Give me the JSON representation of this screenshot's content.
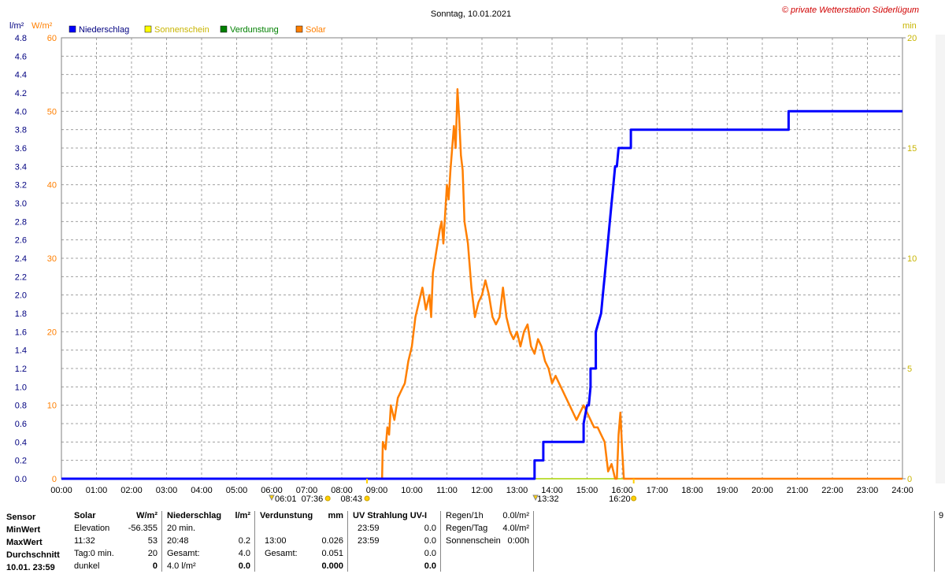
{
  "header": {
    "title": "Sonntag, 10.01.2021",
    "copyright": "© private Wetterstation Süderlügum",
    "unit_left1": "l/m²",
    "unit_left2": "W/m²",
    "unit_right": "min"
  },
  "legend": [
    {
      "label": "Niederschlag",
      "color": "#0000ff"
    },
    {
      "label": "Sonnenschein",
      "color": "#ffff00"
    },
    {
      "label": "Verdunstung",
      "color": "#008000"
    },
    {
      "label": "Solar",
      "color": "#ff7f00"
    }
  ],
  "markers": {
    "sunrise": "07:36",
    "civil_dawn": "06:01",
    "sun_start": "08:43",
    "mid": "13:32",
    "sun_end": "16:20"
  },
  "chart_data": {
    "type": "line",
    "title": "Sonntag, 10.01.2021",
    "x_ticks": [
      "00:00",
      "01:00",
      "02:00",
      "03:00",
      "04:00",
      "05:00",
      "06:00",
      "07:00",
      "08:00",
      "09:00",
      "10:00",
      "11:00",
      "12:00",
      "13:00",
      "14:00",
      "15:00",
      "16:00",
      "17:00",
      "18:00",
      "19:00",
      "20:00",
      "21:00",
      "22:00",
      "23:00",
      "24:00"
    ],
    "y_left_precip": {
      "label": "l/m²",
      "range": [
        0,
        4.8
      ],
      "ticks": [
        "0.0",
        "0.2",
        "0.4",
        "0.6",
        "0.8",
        "1.0",
        "1.2",
        "1.4",
        "1.6",
        "1.8",
        "2.0",
        "2.2",
        "2.4",
        "2.6",
        "2.8",
        "3.0",
        "3.2",
        "3.4",
        "3.6",
        "3.8",
        "4.0",
        "4.2",
        "4.4",
        "4.6",
        "4.8"
      ]
    },
    "y_left_solar": {
      "label": "W/m²",
      "range": [
        0,
        60
      ],
      "ticks": [
        "0",
        "10",
        "20",
        "30",
        "40",
        "50",
        "60"
      ]
    },
    "y_right_minutes": {
      "label": "min",
      "range": [
        0,
        20
      ],
      "ticks": [
        "0",
        "5",
        "10",
        "15",
        "20"
      ]
    },
    "grid": true,
    "series": [
      {
        "name": "Niederschlag",
        "color": "#0000ff",
        "unit": "l/m²",
        "x_hours": [
          0,
          13.5,
          13.5,
          13.75,
          13.75,
          14.9,
          14.9,
          15.0,
          15.05,
          15.1,
          15.1,
          15.25,
          15.25,
          15.4,
          15.45,
          15.5,
          15.6,
          15.65,
          15.7,
          15.75,
          15.8,
          15.85,
          15.9,
          15.95,
          16.0,
          16.0,
          16.25,
          16.25,
          20.75,
          20.75,
          24
        ],
        "values": [
          0,
          0,
          0.2,
          0.2,
          0.4,
          0.4,
          0.6,
          0.8,
          0.8,
          1.0,
          1.2,
          1.2,
          1.6,
          1.8,
          2.0,
          2.2,
          2.6,
          2.8,
          3.0,
          3.2,
          3.4,
          3.4,
          3.6,
          3.6,
          3.6,
          3.6,
          3.6,
          3.8,
          3.8,
          4.0,
          4.0
        ]
      },
      {
        "name": "Solar",
        "color": "#ff7f00",
        "unit": "W/m²",
        "x_hours": [
          0,
          9.15,
          9.17,
          9.25,
          9.3,
          9.35,
          9.4,
          9.5,
          9.6,
          9.7,
          9.8,
          9.9,
          10.0,
          10.1,
          10.2,
          10.3,
          10.4,
          10.5,
          10.55,
          10.6,
          10.7,
          10.8,
          10.85,
          10.9,
          11.0,
          11.05,
          11.1,
          11.2,
          11.25,
          11.3,
          11.35,
          11.4,
          11.45,
          11.5,
          11.6,
          11.7,
          11.8,
          11.9,
          12.0,
          12.1,
          12.2,
          12.3,
          12.4,
          12.5,
          12.6,
          12.7,
          12.8,
          12.9,
          13.0,
          13.1,
          13.2,
          13.3,
          13.4,
          13.5,
          13.6,
          13.7,
          13.8,
          13.9,
          14.0,
          14.1,
          14.2,
          14.3,
          14.4,
          14.5,
          14.6,
          14.7,
          14.8,
          14.9,
          15.0,
          15.1,
          15.2,
          15.3,
          15.4,
          15.5,
          15.55,
          15.6,
          15.7,
          15.75,
          15.8,
          15.85,
          15.9,
          15.95,
          16.0,
          16.05,
          24
        ],
        "values": [
          0,
          0,
          5,
          4,
          7,
          6,
          10,
          8,
          11,
          12,
          13,
          16,
          18,
          22,
          24,
          26,
          23,
          25,
          22,
          28,
          31,
          34,
          35,
          32,
          40,
          38,
          42,
          48,
          45,
          53,
          49,
          44,
          42,
          35,
          32,
          26,
          22,
          24,
          25,
          27,
          25,
          22,
          21,
          22,
          26,
          22,
          20,
          19,
          20,
          18,
          20,
          21,
          18,
          17,
          19,
          18,
          16,
          15,
          13,
          14,
          13,
          12,
          11,
          10,
          9,
          8,
          9,
          10,
          9,
          8,
          7,
          7,
          6,
          5,
          3,
          1,
          2,
          1,
          0,
          0,
          6,
          9,
          4,
          0,
          0
        ]
      },
      {
        "name": "Sonnenschein",
        "color": "#ffff00",
        "unit": "min",
        "x_hours": [
          0,
          24
        ],
        "values": [
          0,
          0
        ]
      },
      {
        "name": "Verdunstung",
        "color": "#008000",
        "unit": "mm",
        "x_hours": [
          0,
          16.25,
          24
        ],
        "values": [
          0,
          0,
          0
        ]
      }
    ]
  },
  "stats": {
    "row_labels": [
      "Sensor",
      "MinWert",
      "MaxWert",
      "Durchschnitt",
      "10.01. 23:59"
    ],
    "solar": {
      "head": "Solar",
      "unit": "W/m²",
      "rows": [
        [
          "Elevation",
          "-56.355"
        ],
        [
          "11:32",
          "53"
        ],
        [
          "Tag:0 min.",
          "20"
        ],
        [
          "dunkel",
          "0"
        ]
      ]
    },
    "niederschlag": {
      "head": "Niederschlag",
      "unit": "l/m²",
      "rows": [
        [
          "20 min.",
          ""
        ],
        [
          "20:48",
          "0.2"
        ],
        [
          "Gesamt:",
          "4.0"
        ],
        [
          "4.0 l/m²",
          "0.0"
        ]
      ]
    },
    "verdunstung": {
      "head": "Verdunstung",
      "unit": "mm",
      "rows": [
        [
          "",
          ""
        ],
        [
          "13:00",
          "0.026"
        ],
        [
          "Gesamt:",
          "0.051"
        ],
        [
          "",
          "0.000"
        ]
      ]
    },
    "uv": {
      "head": "UV Strahlung UV-I",
      "rows": [
        [
          "23:59",
          "0.0"
        ],
        [
          "23:59",
          "0.0"
        ],
        [
          "",
          "0.0"
        ],
        [
          "",
          "0.0"
        ]
      ]
    },
    "regen": {
      "rows": [
        [
          "Regen/1h",
          "0.0l/m²"
        ],
        [
          "Regen/Tag",
          "4.0l/m²"
        ],
        [
          "Sonnenschein",
          "0:00h"
        ]
      ]
    },
    "right_edge": "9"
  }
}
